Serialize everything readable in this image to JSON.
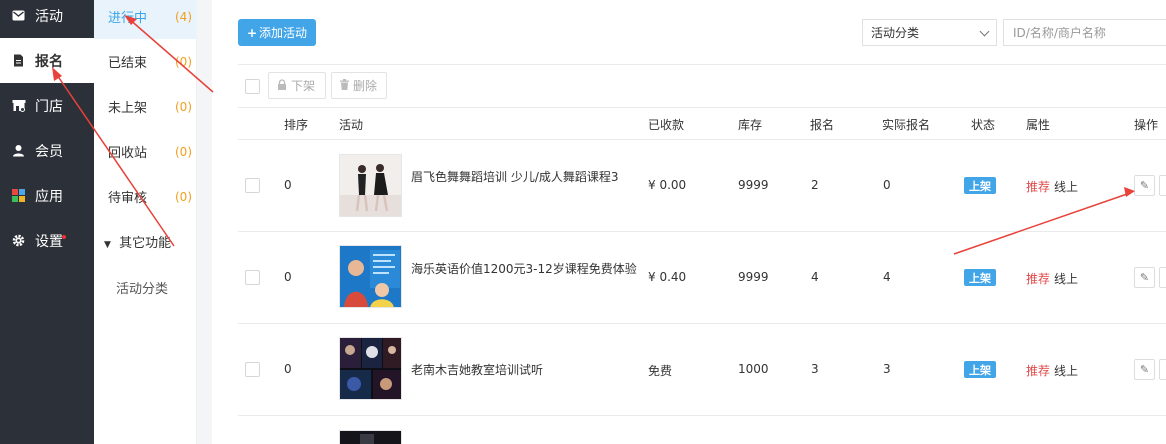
{
  "nav": {
    "items": [
      {
        "label": "活动",
        "icon": "mail-icon"
      },
      {
        "label": "报名",
        "icon": "document-icon"
      },
      {
        "label": "门店",
        "icon": "store-icon"
      },
      {
        "label": "会员",
        "icon": "user-icon"
      },
      {
        "label": "应用",
        "icon": "apps-icon"
      },
      {
        "label": "设置",
        "icon": "gear-icon"
      }
    ],
    "active_index": 1
  },
  "subnav": {
    "items": [
      {
        "label": "进行中",
        "count": "(4)"
      },
      {
        "label": "已结束",
        "count": "(0)"
      },
      {
        "label": "未上架",
        "count": "(0)"
      },
      {
        "label": "回收站",
        "count": "(0)"
      },
      {
        "label": "待审核",
        "count": "(0)"
      }
    ],
    "group_label": "其它功能",
    "group_items": [
      "活动分类"
    ]
  },
  "toolbar": {
    "add_label": "添加活动",
    "category_select": "活动分类",
    "search_placeholder": "ID/名称/商户名称",
    "off_shelf_label": "下架",
    "delete_label": "删除"
  },
  "table": {
    "headers": [
      "排序",
      "活动",
      "已收款",
      "库存",
      "报名",
      "实际报名",
      "状态",
      "属性",
      "操作"
    ],
    "rows": [
      {
        "sort": "0",
        "title": "眉飞色舞舞蹈培训 少儿/成人舞蹈课程3",
        "collected": "¥ 0.00",
        "stock": "9999",
        "signups": "2",
        "actual": "0",
        "status": "上架",
        "attr_recommend": "推荐",
        "attr_online": "线上"
      },
      {
        "sort": "0",
        "title": "海乐英语价值1200元3-12岁课程免费体验",
        "collected": "¥ 0.40",
        "stock": "9999",
        "signups": "4",
        "actual": "4",
        "status": "上架",
        "attr_recommend": "推荐",
        "attr_online": "线上"
      },
      {
        "sort": "0",
        "title": "老南木吉她教室培训试听",
        "collected": "免费",
        "stock": "1000",
        "signups": "3",
        "actual": "3",
        "status": "上架",
        "attr_recommend": "推荐",
        "attr_online": "线上"
      }
    ]
  },
  "colors": {
    "nav_bg": "#2c3038",
    "accent": "#42a5e8",
    "count": "#f0a020",
    "recommend": "#e04a4a",
    "annotation_arrow": "#e8423a"
  }
}
